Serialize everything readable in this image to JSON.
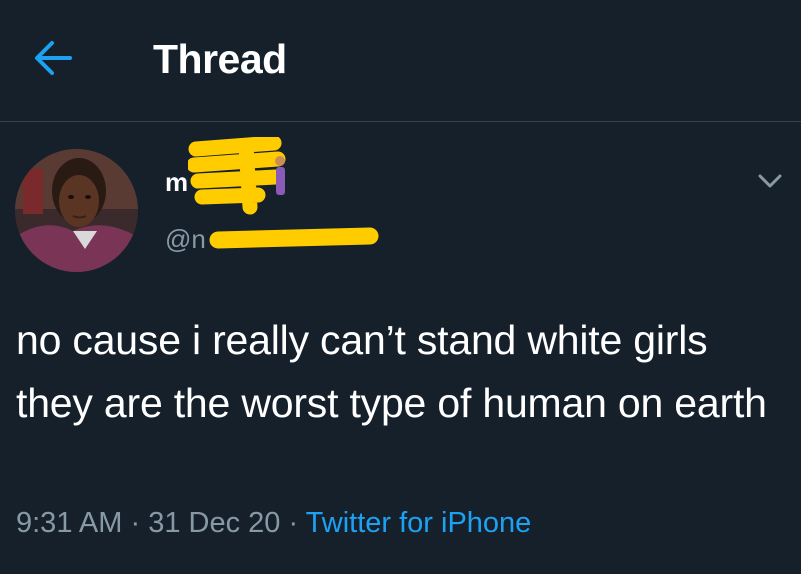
{
  "colors": {
    "background": "#15202b",
    "accent": "#1da1f2",
    "secondary_text": "#8899a6",
    "divider": "#38444d",
    "redaction": "#ffcc00"
  },
  "header": {
    "back_icon": "arrow-left-icon",
    "title": "Thread"
  },
  "tweet": {
    "author": {
      "display_name": "m",
      "handle": "@n",
      "avatar_icon": "profile-photo"
    },
    "more_icon": "chevron-down-icon",
    "text": "no cause i really can’t stand white girls they are the worst type of human on earth",
    "time": "9:31 AM",
    "separator": " · ",
    "date": "31 Dec 20",
    "source": "Twitter for iPhone"
  }
}
